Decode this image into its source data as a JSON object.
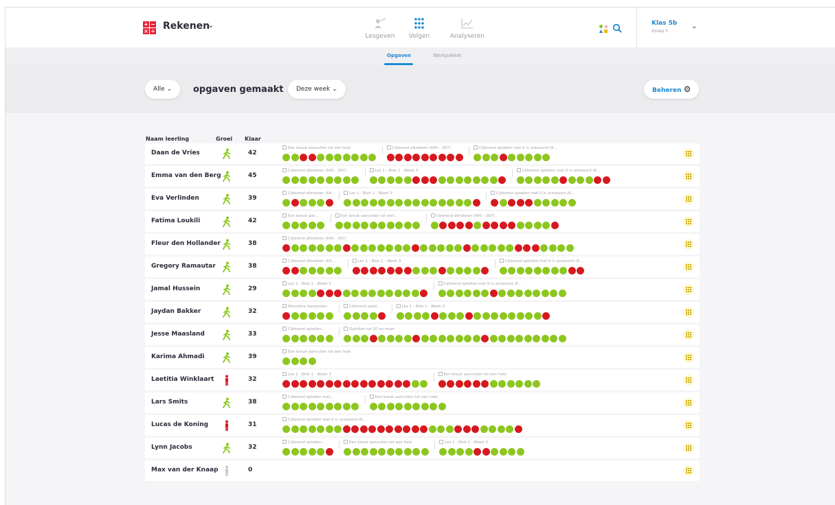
{
  "app": {
    "title": "Rekenen"
  },
  "nav": [
    {
      "label": "Lesgeven",
      "active": false
    },
    {
      "label": "Volgen",
      "active": true
    },
    {
      "label": "Analyseren",
      "active": false
    }
  ],
  "class_selector": {
    "name": "Klas 5b",
    "group": "Groep 5"
  },
  "subtabs": [
    {
      "label": "Opgaven",
      "active": true
    },
    {
      "label": "Werkpakket",
      "active": false
    }
  ],
  "filter": {
    "scope": "Alle",
    "title": "opgaven gemaakt",
    "period": "Deze week",
    "manage": "Beheren"
  },
  "table": {
    "headers": {
      "name": "Naam leerling",
      "growth": "Groei",
      "done": "Klaar"
    },
    "rows": [
      {
        "name": "Daan de Vries",
        "growth": "up",
        "done": "42",
        "segments": [
          {
            "label": "Een breuk aanvullen tot een hele",
            "dots": "ggrrggggggg"
          },
          {
            "label": "Cijferend aftrekken (645 - 267)",
            "dots": "rrrrrrrrr"
          },
          {
            "label": "Cijferend optellen met 0 in antwoord (6...",
            "dots": "gggrggggg"
          }
        ]
      },
      {
        "name": "Emma van den Berg",
        "growth": "up",
        "done": "45",
        "segments": [
          {
            "label": "Cijferend aftrekken (645 - 267)",
            "dots": "ggggggggg"
          },
          {
            "label": "Les 1 - Blok 1 - Week 3",
            "dots": "gggggrrrgggggggr"
          },
          {
            "label": "Cijferend optellen met 0 in antwoord (6...",
            "dots": "gggggrgggrr"
          }
        ]
      },
      {
        "name": "Eva Verlinden",
        "growth": "up",
        "done": "39",
        "segments": [
          {
            "label": "Cijferend aftrekken (64...",
            "dots": "grgggr"
          },
          {
            "label": "Les 1 - Blok 1 - Week 3",
            "dots": "gggggggggggggggr"
          },
          {
            "label": "Cijferend optellen met 0 in antwoord (6...",
            "dots": "rgrrrggggg"
          }
        ]
      },
      {
        "name": "Fatima Loukili",
        "growth": "up",
        "done": "42",
        "segments": [
          {
            "label": "Een breuk aan...",
            "dots": "ggggg"
          },
          {
            "label": "Een breuk aanvullen tot een...",
            "dots": "gggggggggg"
          },
          {
            "label": "Cijferend aftrekken (645 - 267)",
            "dots": "grrrrgrrrrggggr"
          }
        ]
      },
      {
        "name": "Fleur den Hollander",
        "growth": "up",
        "done": "38",
        "segments": [
          {
            "label": "Cijferend aftrekken (645 - 267)",
            "dots": "rggggggrgggggggrgggggrgggggrrrgggg"
          }
        ]
      },
      {
        "name": "Gregory Ramautar",
        "growth": "up",
        "done": "38",
        "segments": [
          {
            "label": "Cijferend aftrekken (64...",
            "dots": "rrggggg"
          },
          {
            "label": "Les 1 - Blok 1 - Week 3",
            "dots": "rrrrrrrgggrggggr"
          },
          {
            "label": "Cijferend optellen met 0 in antwoord (6...",
            "dots": "ggggggggrr"
          }
        ]
      },
      {
        "name": "Jamal Hussein",
        "growth": "up",
        "done": "29",
        "segments": [
          {
            "label": "Les 1 - Blok 1 - Week 3",
            "dots": "ggggrrrgggggggggr"
          },
          {
            "label": "Cijferend optellen met 0 in antwoord (6...",
            "dots": "ggggggrgggggggg"
          }
        ]
      },
      {
        "name": "Jaydan Bakker",
        "growth": "up",
        "done": "32",
        "segments": [
          {
            "label": "Meerdere leerdoelen",
            "dots": "rggggg"
          },
          {
            "label": "Cijferend optel...",
            "dots": "ggggr"
          },
          {
            "label": "Les 1 - Blok 1 - Week 3",
            "dots": "ggggrgggrggggggggr"
          }
        ]
      },
      {
        "name": "Jesse Maasland",
        "growth": "up",
        "done": "33",
        "segments": [
          {
            "label": "Cijferend optellen...",
            "dots": "gggggg"
          },
          {
            "label": "Optellen tot 20 en meer",
            "dots": "gggrggggrgggggggrggggggggg"
          }
        ]
      },
      {
        "name": "Karima Ahmadi",
        "growth": "up",
        "done": "39",
        "segments": [
          {
            "label": "Een breuk aanvullen tot een hele",
            "dots": "gggg"
          }
        ]
      },
      {
        "name": "Laetitia Winklaart",
        "growth": "down",
        "done": "32",
        "segments": [
          {
            "label": "Les 1 - Blok 1 - Week 3",
            "dots": "rrrrrrrrrrrrrrrgg"
          },
          {
            "label": "Een breuk aanvullen tot een hele",
            "dots": "rrrrrrgggggg"
          }
        ]
      },
      {
        "name": "Lars Smits",
        "growth": "up",
        "done": "38",
        "segments": [
          {
            "label": "Cijferend optellen met...",
            "dots": "ggggggggg"
          },
          {
            "label": "Een breuk aanvullen tot een hele",
            "dots": "ggggggggg"
          }
        ]
      },
      {
        "name": "Lucas de Koning",
        "growth": "down",
        "done": "31",
        "segments": [
          {
            "label": "Cijferend optellen met 0 in antwoord (6...",
            "dots": "gggggggrrrrrrrrrrgggrrrggggr"
          }
        ]
      },
      {
        "name": "Lynn Jacobs",
        "growth": "up",
        "done": "32",
        "segments": [
          {
            "label": "Cijferend optellen...",
            "dots": "gggggr"
          },
          {
            "label": "Een breuk aanvullen tot een hele",
            "dots": "gggggggggg"
          },
          {
            "label": "Les 1 - Blok 1 - Week 3",
            "dots": "ggggrrgggg"
          }
        ]
      },
      {
        "name": "Max van der Knaap",
        "growth": "none",
        "done": "0",
        "segments": []
      }
    ]
  },
  "colors": {
    "correct": "#8dc61f",
    "wrong": "#d7191f",
    "accent": "#1e88d2"
  }
}
